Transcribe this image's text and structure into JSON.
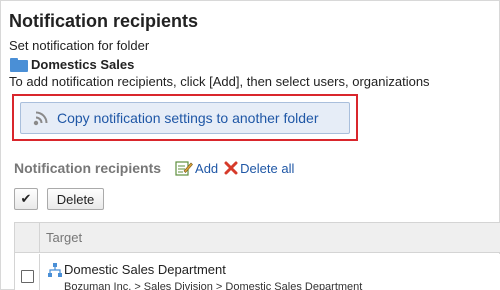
{
  "page": {
    "title": "Notification recipients",
    "subtitle": "Set notification for folder",
    "folder_name": "Domestics Sales",
    "hint": "To add notification recipients, click [Add], then select users, organizations"
  },
  "copy_button": {
    "label": "Copy notification settings to another folder",
    "icon": "broadcast-icon"
  },
  "recipients_section": {
    "title": "Notification recipients",
    "add_label": "Add",
    "delete_all_label": "Delete all"
  },
  "toolbar": {
    "check_all_label": "✔",
    "delete_label": "Delete"
  },
  "table": {
    "header_target": "Target",
    "rows": [
      {
        "name": "Domestic Sales Department",
        "path": "Bozuman Inc. > Sales Division > Domestic Sales Department",
        "icon": "organization-icon"
      }
    ]
  },
  "colors": {
    "link": "#1f57a6",
    "highlight_border": "#d9262c",
    "folder": "#4a8fd6",
    "delete_icon": "#d63a2a"
  }
}
